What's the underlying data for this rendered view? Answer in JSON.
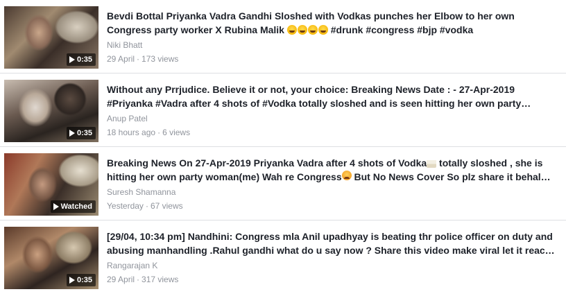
{
  "videos": [
    {
      "duration": "0:35",
      "title": "Bevdi Bottal Priyanka Vadra Gandhi Sloshed with Vodkas punches her Elbow to her own Congress party worker X Rubina Malik",
      "title_suffix": " #drunk #congress #bjp #vodka",
      "author": "Niki Bhatt",
      "date": "29 April",
      "views": "173 views"
    },
    {
      "duration": "0:35",
      "title": "Without any Prrjudice. Believe it or not, your choice: Breaking News Date : - 27-Apr-2019 #Priyanka #Vadra after 4 shots of #Vodka totally sloshed and is seen hitting her own party…",
      "author": "Anup Patel",
      "date": "18 hours ago",
      "views": "6 views"
    },
    {
      "duration": "Watched",
      "title": "Breaking News On 27-Apr-2019 Priyanka Vadra after 4 shots of Vodka",
      "title_mid": " totally sloshed , she is hitting her own party woman(me) Wah re Congress",
      "title_suffix": " But No News Cover So plz share it behal…",
      "author": "Suresh Shamanna",
      "date": "Yesterday",
      "views": "67 views"
    },
    {
      "duration": "0:35",
      "title": "[29/04, 10:34 pm] Nandhini: Congress mla Anil upadhyay is beating thr police officer on duty and abusing manhandling .Rahul gandhi what do u say now ? Share this video make viral let it reac…",
      "author": "Rangarajan K",
      "date": "29 April",
      "views": "317 views"
    }
  ]
}
